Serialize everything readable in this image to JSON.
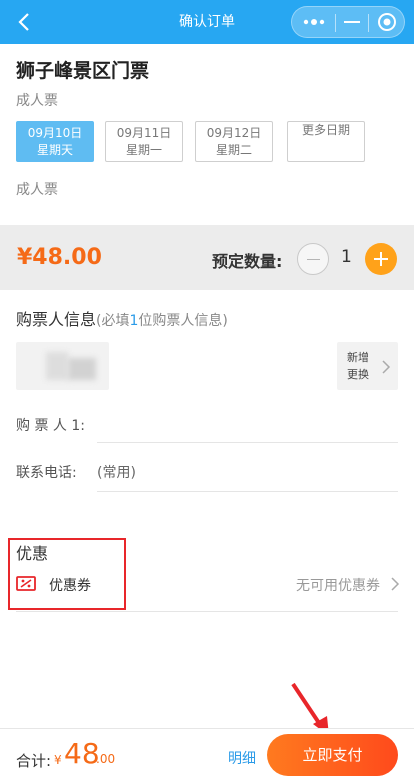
{
  "header": {
    "title": "确认订单",
    "back_icon": "chevron-left-icon",
    "capsule": {
      "more_icon": "more-dots-icon",
      "minimize_icon": "minus-icon",
      "close_icon": "target-circle-icon"
    }
  },
  "product": {
    "name": "狮子峰景区门票",
    "type": "成人票",
    "dates": [
      {
        "date": "09月10日",
        "weekday": "星期天",
        "selected": true
      },
      {
        "date": "09月11日",
        "weekday": "星期一",
        "selected": false
      },
      {
        "date": "09月12日",
        "weekday": "星期二",
        "selected": false
      }
    ],
    "more_dates": "更多日期",
    "ticket_type": "成人票"
  },
  "order": {
    "price": "¥48.00",
    "quantity_label": "预定数量:",
    "quantity": "1"
  },
  "buyer": {
    "title": "购票人信息",
    "hint_prefix": "(必填",
    "hint_num": "1",
    "hint_suffix": "位购票人信息)",
    "add_label_line1": "新增",
    "add_label_line2": "更换",
    "buyer_field_label": "购 票 人 1:",
    "phone_field_label": "联系电话:",
    "phone_hint": "(常用)"
  },
  "coupon": {
    "title": "优惠",
    "label": "优惠券",
    "value": "无可用优惠券"
  },
  "footer": {
    "total_label": "合计:",
    "currency": "¥",
    "amount_int": "48",
    "amount_dec": ".00",
    "detail_label": "明细",
    "pay_label": "立即支付"
  },
  "colors": {
    "header": "#27a7f2",
    "accent_orange": "#f56a17",
    "link_blue": "#2b9be8",
    "highlight_red": "#e8262a",
    "selected_date": "#5fbcf2"
  }
}
